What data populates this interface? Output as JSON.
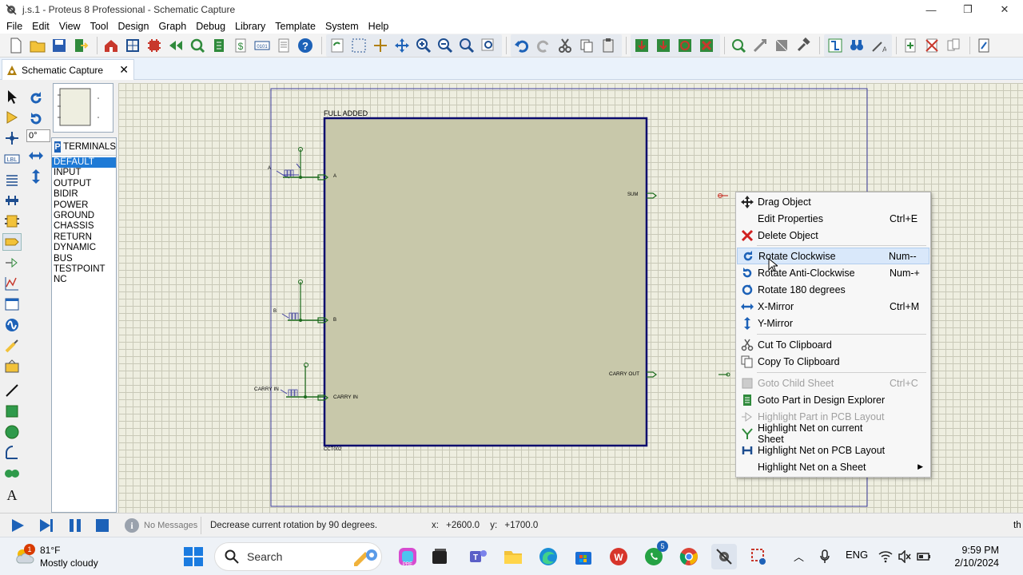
{
  "window": {
    "title": "j.s.1 - Proteus 8 Professional - Schematic Capture",
    "minimize": "—",
    "restore": "❐",
    "close": "✕"
  },
  "menu": [
    "File",
    "Edit",
    "View",
    "Tool",
    "Design",
    "Graph",
    "Debug",
    "Library",
    "Template",
    "System",
    "Help"
  ],
  "tab": {
    "label": "Schematic Capture",
    "close": "✕"
  },
  "rotation": {
    "angle": "0°"
  },
  "terminals": {
    "badge": "P",
    "title": "TERMINALS",
    "items": [
      "DEFAULT",
      "INPUT",
      "OUTPUT",
      "BIDIR",
      "POWER",
      "GROUND",
      "CHASSIS",
      "RETURN",
      "DYNAMIC",
      "BUS",
      "TESTPOINT",
      "NC"
    ],
    "selected": "DEFAULT"
  },
  "left_tools": [
    "select-icon",
    "component-icon",
    "junction-icon",
    "label-icon",
    "text-script-icon",
    "bus-icon",
    "subcircuit-icon",
    "terminal-icon",
    "device-pin-icon",
    "graph-icon",
    "tape-icon",
    "generator-icon",
    "probe-icon",
    "virtual-instrument-icon",
    "line-icon",
    "box-icon",
    "circle-icon",
    "arc-icon",
    "path-icon",
    "text-icon"
  ],
  "schematic": {
    "block_title": "FULL ADDED",
    "block_ref": "CCT002",
    "inputs": [
      {
        "gen_label": "A",
        "pin_label": "A"
      },
      {
        "gen_label": "B",
        "pin_label": "B"
      },
      {
        "gen_label": "CARRY IN",
        "pin_label": "CARRY IN"
      }
    ],
    "outputs": [
      "SUM",
      "CARRY OUT"
    ]
  },
  "context_menu": {
    "items": [
      {
        "label": "Drag Object",
        "shortcut": "",
        "icon": "move-icon",
        "disabled": false
      },
      {
        "label": "Edit Properties",
        "shortcut": "Ctrl+E",
        "icon": "",
        "disabled": false
      },
      {
        "label": "Delete Object",
        "shortcut": "",
        "icon": "delete-x-icon",
        "disabled": false
      },
      {
        "label": "Rotate Clockwise",
        "shortcut": "Num--",
        "icon": "rotate-cw-icon",
        "disabled": false,
        "hover": true
      },
      {
        "label": "Rotate Anti-Clockwise",
        "shortcut": "Num-+",
        "icon": "rotate-ccw-icon",
        "disabled": false
      },
      {
        "label": "Rotate 180 degrees",
        "shortcut": "",
        "icon": "rotate-180-icon",
        "disabled": false
      },
      {
        "label": "X-Mirror",
        "shortcut": "Ctrl+M",
        "icon": "x-mirror-icon",
        "disabled": false
      },
      {
        "label": "Y-Mirror",
        "shortcut": "",
        "icon": "y-mirror-icon",
        "disabled": false
      },
      {
        "label": "Cut To Clipboard",
        "shortcut": "",
        "icon": "scissors-icon",
        "disabled": false
      },
      {
        "label": "Copy To Clipboard",
        "shortcut": "",
        "icon": "copy-icon",
        "disabled": false
      },
      {
        "label": "Goto Child Sheet",
        "shortcut": "Ctrl+C",
        "icon": "child-sheet-icon",
        "disabled": true
      },
      {
        "label": "Goto Part in Design Explorer",
        "shortcut": "",
        "icon": "design-explorer-icon",
        "disabled": false
      },
      {
        "label": "Highlight Part in PCB Layout",
        "shortcut": "",
        "icon": "pcb-part-icon",
        "disabled": true
      },
      {
        "label": "Highlight Net on current Sheet",
        "shortcut": "",
        "icon": "net-sheet-icon",
        "disabled": false
      },
      {
        "label": "Highlight Net on PCB Layout",
        "shortcut": "",
        "icon": "net-pcb-icon",
        "disabled": false
      },
      {
        "label": "Highlight Net on a Sheet",
        "shortcut": "",
        "icon": "",
        "disabled": false,
        "submenu": true
      }
    ],
    "submenu_arrow": "▶"
  },
  "status": {
    "messages": "No Messages",
    "info_glyph": "i",
    "hint": "Decrease current rotation by 90 degrees.",
    "x_label": "x:",
    "x_value": "+2600.0",
    "y_label": "y:",
    "y_value": "+1700.0",
    "right_text": "th"
  },
  "taskbar": {
    "weather_badge": "1",
    "temp": "81°F",
    "weather": "Mostly cloudy",
    "search_placeholder": "Search",
    "whatsapp_badge": "5",
    "lang": "ENG",
    "time": "9:59 PM",
    "date": "2/10/2024",
    "tray_chevron": "︿"
  },
  "colors": {
    "canvas_bg": "#eeeee0",
    "grid": "#c9c9b8",
    "block_fill": "#c8c8aa",
    "block_border": "#0a0a6e",
    "wire": "#1d6b1d",
    "sheet_border": "#4040a0",
    "accent": "#1e7ad6"
  }
}
